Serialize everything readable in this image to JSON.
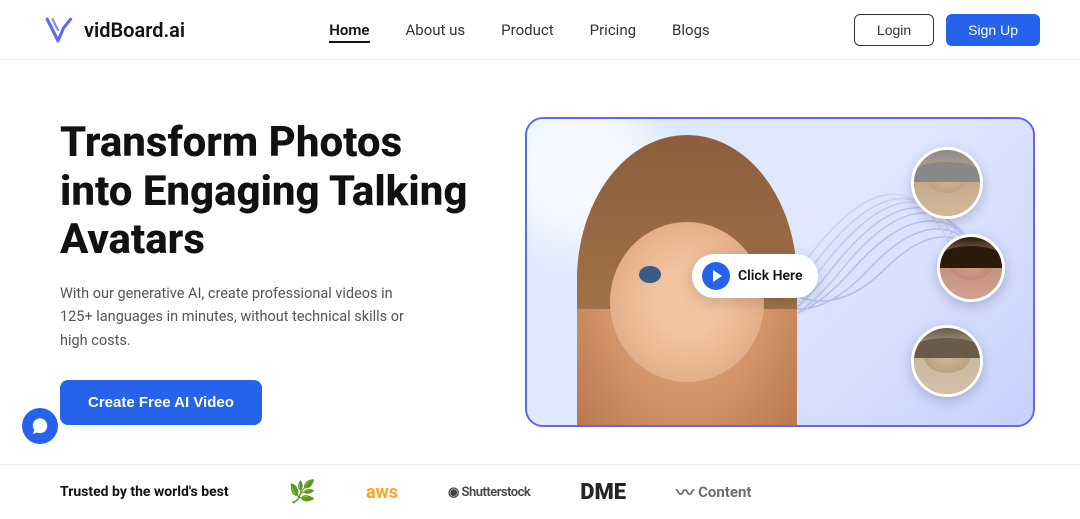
{
  "navbar": {
    "logo_text": "vidBoard.ai",
    "nav_items": [
      {
        "label": "Home",
        "active": true
      },
      {
        "label": "About us",
        "active": false
      },
      {
        "label": "Product",
        "active": false
      },
      {
        "label": "Pricing",
        "active": false
      },
      {
        "label": "Blogs",
        "active": false
      }
    ],
    "login_label": "Login",
    "signup_label": "Sign Up"
  },
  "hero": {
    "title": "Transform Photos into Engaging Talking Avatars",
    "description": "With our generative AI, create professional videos in 125+ languages in minutes, without technical skills or high costs.",
    "cta_label": "Create Free AI Video",
    "click_here_label": "Click Here"
  },
  "trusted": {
    "heading": "Trusted by the world's best",
    "brands": [
      "aws",
      "Shutterstock",
      "DME",
      "Content"
    ]
  },
  "colors": {
    "primary": "#2563eb",
    "text_dark": "#111111",
    "text_muted": "#555555"
  }
}
